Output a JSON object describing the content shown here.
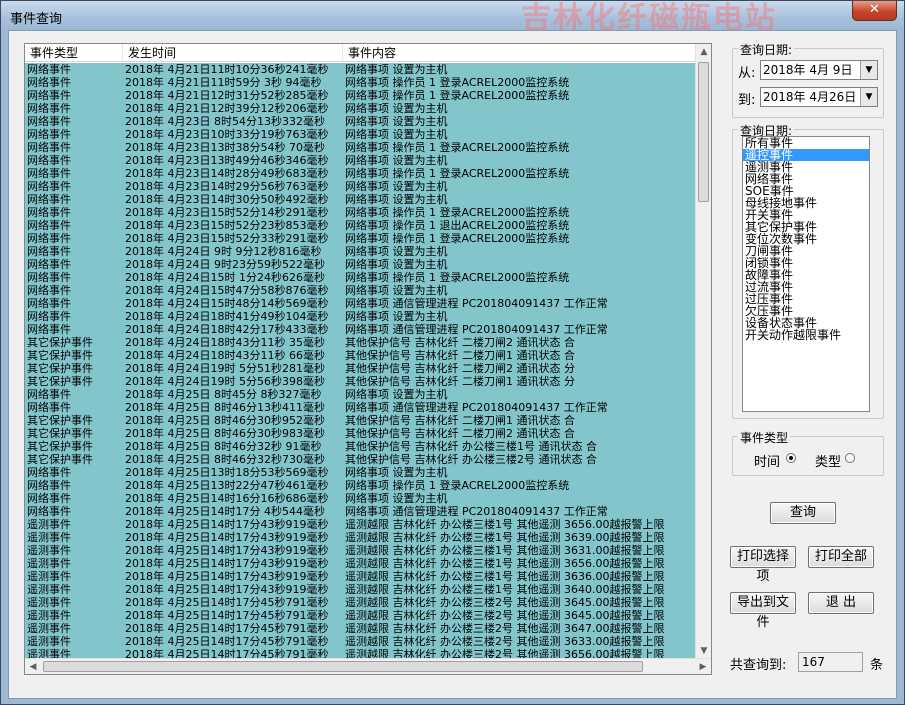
{
  "window": {
    "title": "事件查询",
    "close_label": "✕",
    "bg_ghost_text": "吉林化纤磁瓶电站"
  },
  "table": {
    "columns": [
      "事件类型",
      "发生时间",
      "事件内容"
    ],
    "rows": [
      [
        "网络事件",
        "2018年 4月21日11时10分36秒241毫秒",
        "网络事项 设置为主机"
      ],
      [
        "网络事件",
        "2018年 4月21日11时59分 3秒 94毫秒",
        "网络事项 操作员 1 登录ACREL2000监控系统"
      ],
      [
        "网络事件",
        "2018年 4月21日12时31分52秒285毫秒",
        "网络事项 操作员 1 登录ACREL2000监控系统"
      ],
      [
        "网络事件",
        "2018年 4月21日12时39分12秒206毫秒",
        "网络事项 设置为主机"
      ],
      [
        "网络事件",
        "2018年 4月23日 8时54分13秒332毫秒",
        "网络事项 设置为主机"
      ],
      [
        "网络事件",
        "2018年 4月23日10时33分19秒763毫秒",
        "网络事项 设置为主机"
      ],
      [
        "网络事件",
        "2018年 4月23日13时38分54秒 70毫秒",
        "网络事项 操作员 1 登录ACREL2000监控系统"
      ],
      [
        "网络事件",
        "2018年 4月23日13时49分46秒346毫秒",
        "网络事项 设置为主机"
      ],
      [
        "网络事件",
        "2018年 4月23日14时28分49秒683毫秒",
        "网络事项 操作员 1 登录ACREL2000监控系统"
      ],
      [
        "网络事件",
        "2018年 4月23日14时29分56秒763毫秒",
        "网络事项 设置为主机"
      ],
      [
        "网络事件",
        "2018年 4月23日14时30分50秒492毫秒",
        "网络事项 设置为主机"
      ],
      [
        "网络事件",
        "2018年 4月23日15时52分14秒291毫秒",
        "网络事项 操作员 1 登录ACREL2000监控系统"
      ],
      [
        "网络事件",
        "2018年 4月23日15时52分23秒853毫秒",
        "网络事项 操作员 1 退出ACREL2000监控系统"
      ],
      [
        "网络事件",
        "2018年 4月23日15时52分33秒291毫秒",
        "网络事项 操作员 1 登录ACREL2000监控系统"
      ],
      [
        "网络事件",
        "2018年 4月24日 9时 9分12秒816毫秒",
        "网络事项 设置为主机"
      ],
      [
        "网络事件",
        "2018年 4月24日 9时23分59秒522毫秒",
        "网络事项 设置为主机"
      ],
      [
        "网络事件",
        "2018年 4月24日15时 1分24秒626毫秒",
        "网络事项 操作员 1 登录ACREL2000监控系统"
      ],
      [
        "网络事件",
        "2018年 4月24日15时47分58秒876毫秒",
        "网络事项 设置为主机"
      ],
      [
        "网络事件",
        "2018年 4月24日15时48分14秒569毫秒",
        "网络事项 通信管理进程 PC201804091437 工作正常"
      ],
      [
        "网络事件",
        "2018年 4月24日18时41分49秒104毫秒",
        "网络事项 设置为主机"
      ],
      [
        "网络事件",
        "2018年 4月24日18时42分17秒433毫秒",
        "网络事项 通信管理进程 PC201804091437 工作正常"
      ],
      [
        "其它保护事件",
        "2018年 4月24日18时43分11秒 35毫秒",
        "其他保护信号 吉林化纤 二楼刀闸2 通讯状态  合"
      ],
      [
        "其它保护事件",
        "2018年 4月24日18时43分11秒 66毫秒",
        "其他保护信号 吉林化纤 二楼刀闸1 通讯状态  合"
      ],
      [
        "其它保护事件",
        "2018年 4月24日19时 5分51秒281毫秒",
        "其他保护信号 吉林化纤 二楼刀闸2 通讯状态  分"
      ],
      [
        "其它保护事件",
        "2018年 4月24日19时 5分56秒398毫秒",
        "其他保护信号 吉林化纤 二楼刀闸1 通讯状态  分"
      ],
      [
        "网络事件",
        "2018年 4月25日 8时45分 8秒327毫秒",
        "网络事项 设置为主机"
      ],
      [
        "网络事件",
        "2018年 4月25日 8时46分13秒411毫秒",
        "网络事项 通信管理进程 PC201804091437 工作正常"
      ],
      [
        "其它保护事件",
        "2018年 4月25日 8时46分30秒952毫秒",
        "其他保护信号 吉林化纤 二楼刀闸1 通讯状态  合"
      ],
      [
        "其它保护事件",
        "2018年 4月25日 8时46分30秒983毫秒",
        "其他保护信号 吉林化纤 二楼刀闸2 通讯状态  合"
      ],
      [
        "其它保护事件",
        "2018年 4月25日 8时46分32秒 91毫秒",
        "其他保护信号 吉林化纤 办公楼三楼1号 通讯状态  合"
      ],
      [
        "其它保护事件",
        "2018年 4月25日 8时46分32秒730毫秒",
        "其他保护信号 吉林化纤 办公楼三楼2号 通讯状态  合"
      ],
      [
        "网络事件",
        "2018年 4月25日13时18分53秒569毫秒",
        "网络事项 设置为主机"
      ],
      [
        "网络事件",
        "2018年 4月25日13时22分47秒461毫秒",
        "网络事项 操作员 1 登录ACREL2000监控系统"
      ],
      [
        "网络事件",
        "2018年 4月25日14时16分16秒686毫秒",
        "网络事项 设置为主机"
      ],
      [
        "网络事件",
        "2018年 4月25日14时17分 4秒544毫秒",
        "网络事项 通信管理进程 PC201804091437 工作正常"
      ],
      [
        "遥测事件",
        "2018年 4月25日14时17分43秒919毫秒",
        "遥测越限 吉林化纤 办公楼三楼1号 其他遥测 3656.00越报警上限"
      ],
      [
        "遥测事件",
        "2018年 4月25日14时17分43秒919毫秒",
        "遥测越限 吉林化纤 办公楼三楼1号 其他遥测 3639.00越报警上限"
      ],
      [
        "遥测事件",
        "2018年 4月25日14时17分43秒919毫秒",
        "遥测越限 吉林化纤 办公楼三楼1号 其他遥测 3631.00越报警上限"
      ],
      [
        "遥测事件",
        "2018年 4月25日14时17分43秒919毫秒",
        "遥测越限 吉林化纤 办公楼三楼1号 其他遥测 3656.00越报警上限"
      ],
      [
        "遥测事件",
        "2018年 4月25日14时17分43秒919毫秒",
        "遥测越限 吉林化纤 办公楼三楼1号 其他遥测 3636.00越报警上限"
      ],
      [
        "遥测事件",
        "2018年 4月25日14时17分43秒919毫秒",
        "遥测越限 吉林化纤 办公楼三楼1号 其他遥测 3640.00越报警上限"
      ],
      [
        "遥测事件",
        "2018年 4月25日14时17分45秒791毫秒",
        "遥测越限 吉林化纤 办公楼三楼2号 其他遥测 3645.00越报警上限"
      ],
      [
        "遥测事件",
        "2018年 4月25日14时17分45秒791毫秒",
        "遥测越限 吉林化纤 办公楼三楼2号 其他遥测 3645.00越报警上限"
      ],
      [
        "遥测事件",
        "2018年 4月25日14时17分45秒791毫秒",
        "遥测越限 吉林化纤 办公楼三楼2号 其他遥测 3647.00越报警上限"
      ],
      [
        "遥测事件",
        "2018年 4月25日14时17分45秒791毫秒",
        "遥测越限 吉林化纤 办公楼三楼2号 其他遥测 3633.00越报警上限"
      ],
      [
        "遥测事件",
        "2018年 4月25日14时17分45秒791毫秒",
        "遥测越限 吉林化纤 办公楼三楼2号 其他遥测 3656.00越报警上限"
      ]
    ]
  },
  "query": {
    "group_label": "查询日期:",
    "from_label": "从:",
    "from_value": "2018年 4月 9日",
    "to_label": "到:",
    "to_value": "2018年 4月26日"
  },
  "event_filter": {
    "group_label": "查询日期:",
    "items": [
      "所有事件",
      "遥控事件",
      "遥测事件",
      "网络事件",
      "SOE事件",
      "母线接地事件",
      "开关事件",
      "其它保护事件",
      "变位次数事件",
      "刀闸事件",
      "闭锁事件",
      "故障事件",
      "过流事件",
      "过压事件",
      "欠压事件",
      "设备状态事件",
      "开关动作越限事件"
    ],
    "selected_index": 1
  },
  "sort": {
    "group_label": "事件类型",
    "time_label": "时间",
    "type_label": "类型",
    "selected": "时间"
  },
  "buttons": {
    "query": "查询",
    "print_selected": "打印选择项",
    "print_all": "打印全部",
    "export": "导出到文件",
    "exit": "退 出"
  },
  "footer": {
    "count_label": "共查询到:",
    "count_value": "167",
    "count_unit": "条"
  },
  "colors": {
    "row_bg": "#82c6cc",
    "title_bg": "#a7c1db",
    "list_select": "#3399ff"
  }
}
